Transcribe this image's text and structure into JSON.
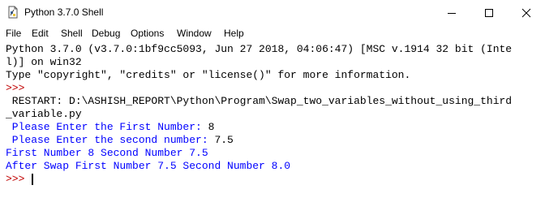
{
  "window": {
    "title": "Python 3.7.0 Shell"
  },
  "menu": {
    "items": [
      "File",
      "Edit",
      "Shell",
      "Debug",
      "Options",
      "Window",
      "Help"
    ]
  },
  "shell": {
    "banner_line1": "Python 3.7.0 (v3.7.0:1bf9cc5093, Jun 27 2018, 04:06:47) [MSC v.1914 32 bit (Inte",
    "banner_line2": "l)] on win32",
    "banner_line3": "Type \"copyright\", \"credits\" or \"license()\" for more information.",
    "prompt1": ">>>",
    "restart_line1": " RESTART: D:\\ASHISH_REPORT\\Python\\Program\\Swap_two_variables_without_using_third",
    "restart_line2": "_variable.py",
    "input1_label": " Please Enter the First Number: ",
    "input1_value": "8",
    "input2_label": " Please Enter the second number: ",
    "input2_value": "7.5",
    "output1": "First Number 8 Second Number 7.5",
    "output2": "After Swap First Number 7.5 Second Number 8.0",
    "prompt2": ">>> "
  },
  "colors": {
    "prompt": "#c00000",
    "output": "#0000ff",
    "text": "#000000"
  },
  "icons": [
    "python-idle-icon",
    "minimize-icon",
    "maximize-icon",
    "close-icon"
  ]
}
